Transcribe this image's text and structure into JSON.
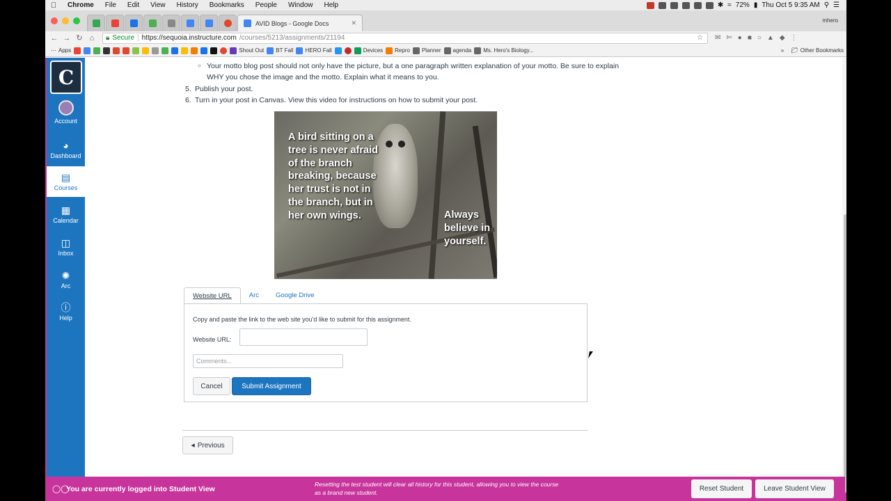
{
  "menubar": {
    "items": [
      "Chrome",
      "File",
      "Edit",
      "View",
      "History",
      "Bookmarks",
      "People",
      "Window",
      "Help"
    ],
    "battery": "72%",
    "datetime": "Thu Oct 5  9:35 AM"
  },
  "browser": {
    "active_tab_title": "AVID Blogs - Google Docs",
    "profile": "mhero",
    "secure_label": "Secure",
    "url_host": "https://sequoia.instructure.com",
    "url_path": "/courses/5213/assignments/21194"
  },
  "bookmarks": {
    "apps": "Apps",
    "items": [
      "Shout Out",
      "BT Fall",
      "HERO Fall",
      "Devices",
      "Repro",
      "Planner",
      "agenda",
      "Ms. Hero's Biology..."
    ],
    "other": "Other Bookmarks"
  },
  "sidebar": {
    "logo_text": "C",
    "items": [
      {
        "label": "Account",
        "icon": "account-avatar"
      },
      {
        "label": "Dashboard",
        "icon": "dashboard-icon"
      },
      {
        "label": "Courses",
        "icon": "courses-icon"
      },
      {
        "label": "Calendar",
        "icon": "calendar-icon"
      },
      {
        "label": "Inbox",
        "icon": "inbox-icon"
      },
      {
        "label": "Arc",
        "icon": "arc-icon"
      },
      {
        "label": "Help",
        "icon": "help-icon"
      }
    ]
  },
  "assignment": {
    "bullet": "Your motto blog post should not only have the picture, but a one paragraph written explanation of your motto.  Be sure to explain WHY you chose the image and the motto.  Explain what it means to you.",
    "step5_num": "5.",
    "step5": "Publish your post.",
    "step6_num": "6.",
    "step6": "Turn in your post in Canvas.  View this video for instructions on how to submit your post.",
    "image_caption_left": "A bird sitting on a tree is never afraid of the branch breaking, because her trust is not in the branch, but in her own wings.",
    "image_caption_right": "Always believe in yourself."
  },
  "submission": {
    "tabs": [
      "Website URL",
      "Arc",
      "Google Drive"
    ],
    "instructions": "Copy and paste the link to the web site you'd like to submit for this assignment.",
    "url_label": "Website URL:",
    "url_value": "",
    "comments_placeholder": "Comments...",
    "cancel": "Cancel",
    "submit": "Submit Assignment"
  },
  "pager": {
    "previous": "Previous"
  },
  "student_view": {
    "message": "You are currently logged into Student View",
    "note": "Resetting the test student will clear all history for this student, allowing you to view the course as a brand new student.",
    "reset": "Reset Student",
    "leave": "Leave Student View"
  },
  "colors": {
    "canvas_blue": "#1d75c0",
    "student_view_magenta": "#c7349c"
  }
}
